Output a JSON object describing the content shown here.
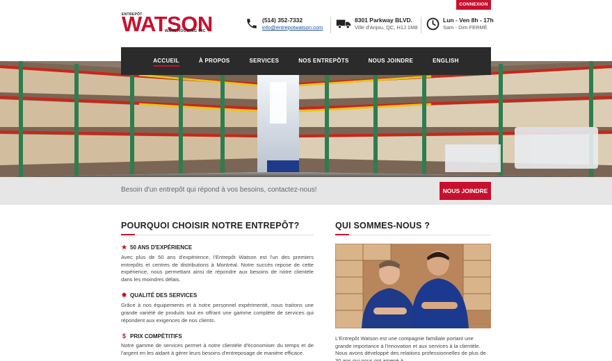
{
  "topbar": {
    "login_label": "CONNEXION"
  },
  "logo": {
    "small": "ENTREPÔT",
    "main": "WATSON",
    "sub": "WAREHOUSING INC"
  },
  "contact": {
    "phone": {
      "icon": "phone-icon",
      "line1": "(514) 352-7332",
      "line2": "info@entrepotwatson.com"
    },
    "address": {
      "icon": "truck-icon",
      "line1": "8301 Parkway BLVD.",
      "line2": "Ville d'Anjou, QC, H1J 1M8"
    },
    "hours": {
      "icon": "clock-icon",
      "line1": "Lun - Ven 8h - 17h",
      "line2": "Sam - Dim FERMÉ"
    }
  },
  "nav": {
    "items": [
      {
        "label": "ACCUEIL",
        "active": true
      },
      {
        "label": "À PROPOS"
      },
      {
        "label": "SERVICES"
      },
      {
        "label": "NOS ENTREPÔTS"
      },
      {
        "label": "NOUS JOINDRE"
      },
      {
        "label": "ENGLISH"
      }
    ]
  },
  "cta": {
    "message": "Besoin d'un entrepôt qui répond à vos besoins, contactez-nous!",
    "button": "NOUS JOINDRE"
  },
  "why": {
    "title": "POURQUOI CHOISIR NOTRE ENTREPÔT?",
    "features": [
      {
        "icon": "star-icon",
        "title": "50 ANS D'EXPÉRIENCE",
        "text": "Avec plus de 50 ans d'expérience, l'Entrepôt Watson est l'un des premiers entrepôts et centres de distributions à Montréal. Notre succès repose de cette expérience, nous permettant ainsi de répondre aux besoins de notre clientèle dans les moindres délais."
      },
      {
        "icon": "gear-icon",
        "title": "QUALITÉ DES SERVICES",
        "text": "Grâce à nos équipements et à notre personnel expérimenté, nous traitons une grande variété de produits tout en offrant une gamme complète de services qui répondent aux exigences de nos clients."
      },
      {
        "icon": "dollar-icon",
        "title": "PRIX COMPÉTITIFS",
        "text": "Notre gamme de services permet à notre clientèle d'économiser du temps et de l'argent en les aidant à gérer leurs besoins d'entreposage de manière efficace."
      }
    ]
  },
  "about": {
    "title": "QUI SOMMES-NOUS ?",
    "text": "L'Entrepôt Watson est une compagnie familiale portant une grande importance à l'innovation et aux services à la clientèle. Nous avons développé des relations professionnelles de plus de 30 ans qui nous ont amené à"
  }
}
